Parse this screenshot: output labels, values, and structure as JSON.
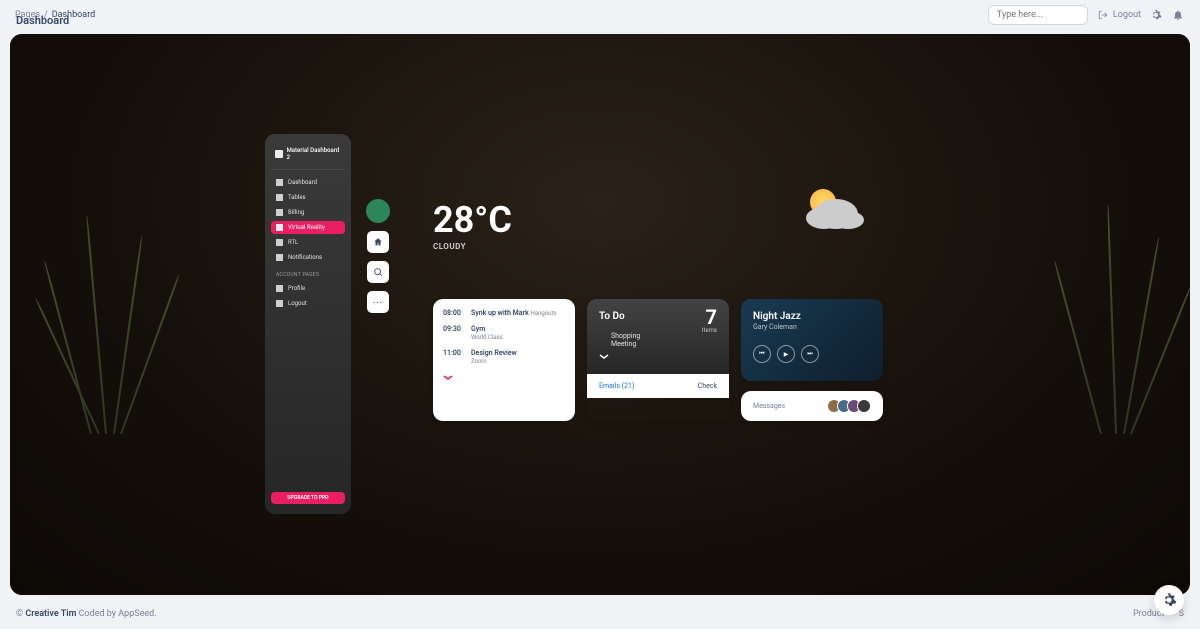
{
  "breadcrumb": {
    "root": "Pages",
    "current": "Dashboard"
  },
  "page_title": "Dashboard",
  "search": {
    "placeholder": "Type here..."
  },
  "top_actions": {
    "logout": "Logout"
  },
  "sidebar": {
    "brand": "Material Dashboard 2",
    "items": [
      {
        "label": "Dashboard"
      },
      {
        "label": "Tables"
      },
      {
        "label": "Billing"
      },
      {
        "label": "Virtual Reality"
      },
      {
        "label": "RTL"
      },
      {
        "label": "Notifications"
      }
    ],
    "section": "ACCOUNT PAGES",
    "account": [
      {
        "label": "Profile"
      },
      {
        "label": "Logout"
      }
    ],
    "upgrade": "UPGRADE TO PRO"
  },
  "weather": {
    "temp": "28°C",
    "condition": "CLOUDY"
  },
  "schedule": [
    {
      "time": "08:00",
      "title": "Synk up with Mark",
      "sub_inline": "Hangouts"
    },
    {
      "time": "09:30",
      "title": "Gym",
      "sub": "World Class"
    },
    {
      "time": "11:00",
      "title": "Design Review",
      "sub": "Zoom"
    }
  ],
  "todo": {
    "title": "To Do",
    "count": "7",
    "items_label": "Items",
    "list": [
      "Shopping",
      "Meeting"
    ],
    "emails": "Emails (21)",
    "check": "Check"
  },
  "music": {
    "title": "Night Jazz",
    "artist": "Gary Coleman"
  },
  "messages": {
    "label": "Messages"
  },
  "footer": {
    "left_pre": "© ",
    "left_bold": "Creative Tim",
    "left_post": " Coded by AppSeed.",
    "right": [
      "Product",
      "S"
    ]
  },
  "colors": {
    "accent": "#e91e63"
  }
}
